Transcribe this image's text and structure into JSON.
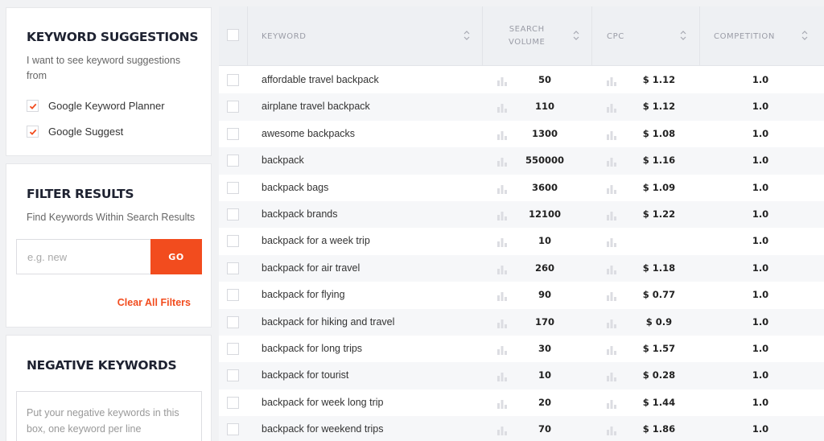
{
  "keyword_suggestions": {
    "title": "KEYWORD SUGGESTIONS",
    "subtitle_line1": "I want to see keyword suggestions",
    "subtitle_line2": "from",
    "options": [
      {
        "label": "Google Keyword Planner",
        "checked": true
      },
      {
        "label": "Google Suggest",
        "checked": true
      }
    ]
  },
  "filter_results": {
    "title": "FILTER RESULTS",
    "subtitle": "Find Keywords Within Search Results",
    "placeholder": "e.g. new",
    "go_label": "GO",
    "clear_label": "Clear All Filters"
  },
  "negative_keywords": {
    "title": "NEGATIVE KEYWORDS",
    "placeholder": "Put your negative keywords in this box, one keyword per line"
  },
  "table": {
    "headers": {
      "keyword": "KEYWORD",
      "search_volume_line1": "SEARCH",
      "search_volume_line2": "VOLUME",
      "cpc": "CPC",
      "competition": "COMPETITION"
    },
    "rows": [
      {
        "keyword": "affordable travel backpack",
        "volume": "50",
        "cpc": "$ 1.12",
        "competition": "1.0"
      },
      {
        "keyword": "airplane travel backpack",
        "volume": "110",
        "cpc": "$ 1.12",
        "competition": "1.0"
      },
      {
        "keyword": "awesome backpacks",
        "volume": "1300",
        "cpc": "$ 1.08",
        "competition": "1.0"
      },
      {
        "keyword": "backpack",
        "volume": "550000",
        "cpc": "$ 1.16",
        "competition": "1.0"
      },
      {
        "keyword": "backpack bags",
        "volume": "3600",
        "cpc": "$ 1.09",
        "competition": "1.0"
      },
      {
        "keyword": "backpack brands",
        "volume": "12100",
        "cpc": "$ 1.22",
        "competition": "1.0"
      },
      {
        "keyword": "backpack for a week trip",
        "volume": "10",
        "cpc": "",
        "competition": "1.0"
      },
      {
        "keyword": "backpack for air travel",
        "volume": "260",
        "cpc": "$ 1.18",
        "competition": "1.0"
      },
      {
        "keyword": "backpack for flying",
        "volume": "90",
        "cpc": "$ 0.77",
        "competition": "1.0"
      },
      {
        "keyword": "backpack for hiking and travel",
        "volume": "170",
        "cpc": "$ 0.9",
        "competition": "1.0"
      },
      {
        "keyword": "backpack for long trips",
        "volume": "30",
        "cpc": "$ 1.57",
        "competition": "1.0"
      },
      {
        "keyword": "backpack for tourist",
        "volume": "10",
        "cpc": "$ 0.28",
        "competition": "1.0"
      },
      {
        "keyword": "backpack for week long trip",
        "volume": "20",
        "cpc": "$ 1.44",
        "competition": "1.0"
      },
      {
        "keyword": "backpack for weekend trips",
        "volume": "70",
        "cpc": "$ 1.86",
        "competition": "1.0"
      }
    ]
  },
  "colors": {
    "accent": "#f24c1e",
    "heading": "#1e2231",
    "background": "#f1f2f4"
  }
}
